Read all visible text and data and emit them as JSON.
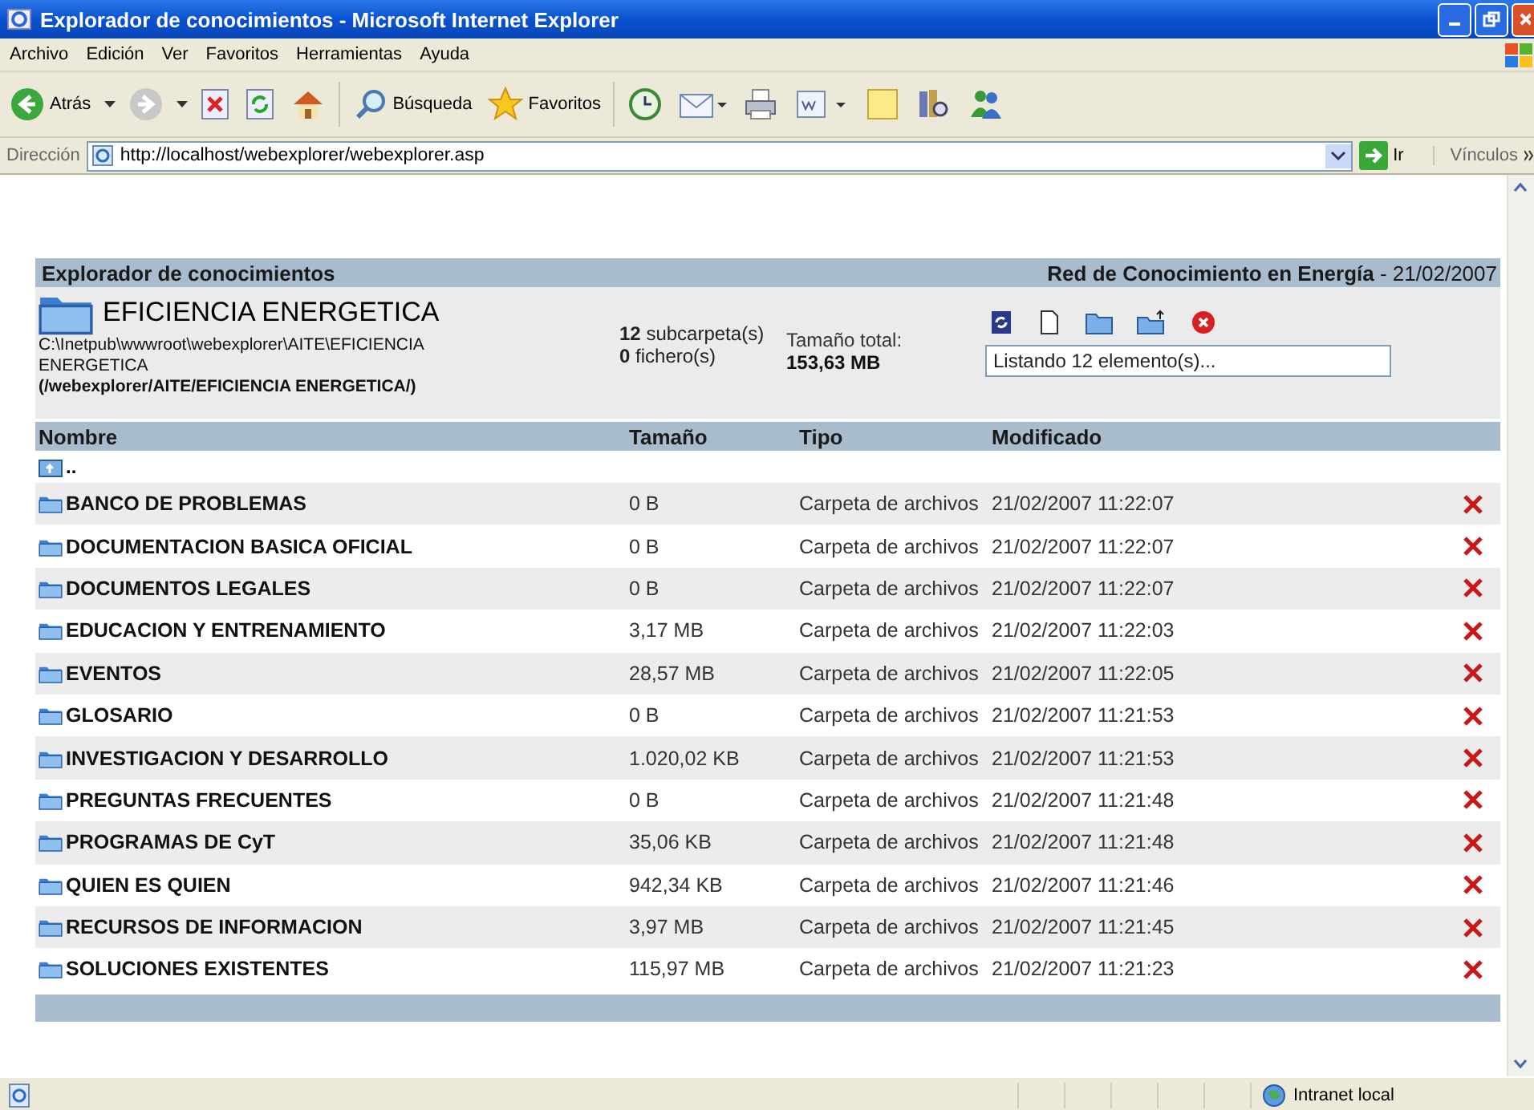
{
  "window": {
    "title": "Explorador de conocimientos - Microsoft Internet Explorer"
  },
  "menu": [
    "Archivo",
    "Edición",
    "Ver",
    "Favoritos",
    "Herramientas",
    "Ayuda"
  ],
  "toolbar": [
    {
      "kind": "back",
      "label": "Atrás"
    },
    {
      "kind": "forward"
    },
    {
      "kind": "stop"
    },
    {
      "kind": "refresh"
    },
    {
      "kind": "home"
    },
    {
      "kind": "search",
      "label": "Búsqueda"
    },
    {
      "kind": "favorites",
      "label": "Favoritos"
    },
    {
      "kind": "history"
    },
    {
      "kind": "mail"
    },
    {
      "kind": "print"
    },
    {
      "kind": "edit"
    },
    {
      "kind": "notes"
    },
    {
      "kind": "research"
    },
    {
      "kind": "messenger"
    }
  ],
  "address": {
    "label": "Dirección",
    "url": "http://localhost/webexplorer/webexplorer.asp",
    "go": "Ir",
    "links": "Vínculos"
  },
  "explorer": {
    "title": "Explorador de conocimientos",
    "site": "**Red de Conocimiento en Energía** - 21/02/2007",
    "folder": "EFICIENCIA ENERGETICA",
    "path": "C:\\Inetpub\\wwwroot\\webexplorer\\AITE\\EFICIENCIA ENERGETICA",
    "virtual_path": "(/webexplorer/AITE/EFICIENCIA ENERGETICA/)",
    "subfolders": "**12** subcarpeta(s)",
    "files": "**0** fichero(s)",
    "total_label": "Tamaño total:",
    "total": "153,63 MB",
    "tools": [
      {
        "kind": "refresh"
      },
      {
        "kind": "new-file"
      },
      {
        "kind": "new-folder"
      },
      {
        "kind": "upload"
      },
      {
        "kind": "delete"
      }
    ],
    "status": "Listando 12 elemento(s)...",
    "columns": [
      "Nombre",
      "Tamaño",
      "Tipo",
      "Modificado"
    ],
    "parent": "..",
    "rows": [
      {
        "name": "BANCO DE PROBLEMAS",
        "size": "0 B",
        "type": "Carpeta de archivos",
        "modified": "21/02/2007 11:22:07"
      },
      {
        "name": "DOCUMENTACION BASICA OFICIAL",
        "size": "0 B",
        "type": "Carpeta de archivos",
        "modified": "21/02/2007 11:22:07"
      },
      {
        "name": "DOCUMENTOS LEGALES",
        "size": "0 B",
        "type": "Carpeta de archivos",
        "modified": "21/02/2007 11:22:07"
      },
      {
        "name": "EDUCACION Y ENTRENAMIENTO",
        "size": "3,17 MB",
        "type": "Carpeta de archivos",
        "modified": "21/02/2007 11:22:03"
      },
      {
        "name": "EVENTOS",
        "size": "28,57 MB",
        "type": "Carpeta de archivos",
        "modified": "21/02/2007 11:22:05"
      },
      {
        "name": "GLOSARIO",
        "size": "0 B",
        "type": "Carpeta de archivos",
        "modified": "21/02/2007 11:21:53"
      },
      {
        "name": "INVESTIGACION Y DESARROLLO",
        "size": "1.020,02 KB",
        "type": "Carpeta de archivos",
        "modified": "21/02/2007 11:21:53"
      },
      {
        "name": "PREGUNTAS FRECUENTES",
        "size": "0 B",
        "type": "Carpeta de archivos",
        "modified": "21/02/2007 11:21:48"
      },
      {
        "name": "PROGRAMAS DE CyT",
        "size": "35,06 KB",
        "type": "Carpeta de archivos",
        "modified": "21/02/2007 11:21:48"
      },
      {
        "name": "QUIEN ES QUIEN",
        "size": "942,34 KB",
        "type": "Carpeta de archivos",
        "modified": "21/02/2007 11:21:46"
      },
      {
        "name": "RECURSOS DE INFORMACION",
        "size": "3,97 MB",
        "type": "Carpeta de archivos",
        "modified": "21/02/2007 11:21:45"
      },
      {
        "name": "SOLUCIONES EXISTENTES",
        "size": "115,97 MB",
        "type": "Carpeta de archivos",
        "modified": "21/02/2007 11:21:23"
      }
    ]
  },
  "status_bar": {
    "zone": "Intranet local"
  }
}
